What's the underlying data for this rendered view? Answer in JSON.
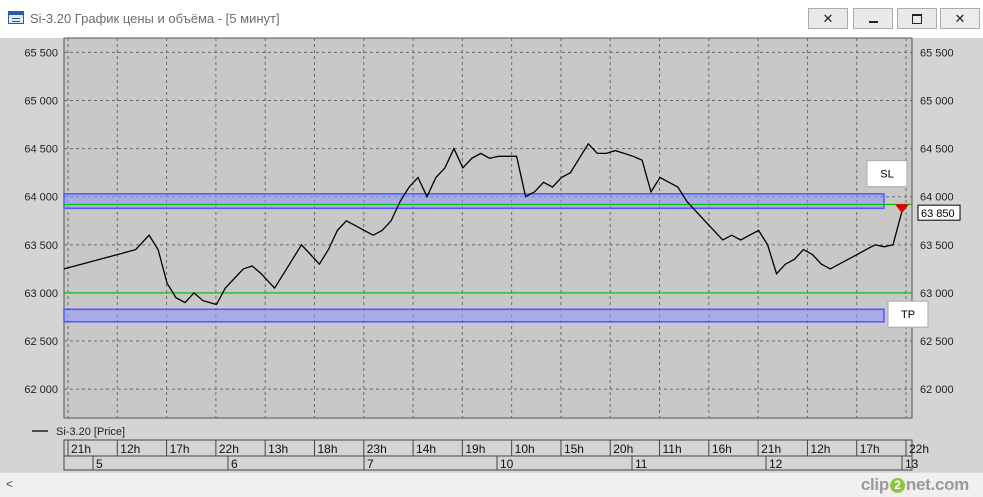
{
  "window": {
    "title": "Si-3.20 График цены и объёма - [5 минут]",
    "controls": [
      "pin-icon",
      "minimize-icon",
      "maximize-icon",
      "close-icon"
    ]
  },
  "watermark": {
    "prefix": "clip",
    "digit": "2",
    "suffix": "net.com"
  },
  "chart_data": {
    "type": "line",
    "title": "",
    "ylim": [
      61700,
      65650
    ],
    "grid": true,
    "y_ticks": [
      62000,
      62500,
      63000,
      63500,
      64000,
      64500,
      65000,
      65500
    ],
    "y_tick_labels": [
      "62 000",
      "62 500",
      "63 000",
      "63 500",
      "64 000",
      "64 500",
      "65 000",
      "65 500"
    ],
    "legend": {
      "position": "bottom-left",
      "entries": [
        "Si-3.20 [Price]"
      ]
    },
    "current_price_label": "63 850",
    "time_labels": [
      "21h",
      "12h",
      "17h",
      "22h",
      "13h",
      "18h",
      "23h",
      "14h",
      "19h",
      "10h",
      "15h",
      "20h",
      "11h",
      "16h",
      "21h",
      "12h",
      "17h",
      "22h"
    ],
    "date_labels": [
      "5",
      "6",
      "7",
      "10",
      "11",
      "12",
      "13"
    ],
    "series": [
      {
        "name": "Si-3.20 [Price]",
        "color": "#000000",
        "points": [
          [
            0,
            63250
          ],
          [
            2,
            63300
          ],
          [
            4,
            63350
          ],
          [
            6,
            63400
          ],
          [
            8,
            63450
          ],
          [
            9.5,
            63600
          ],
          [
            10.5,
            63450
          ],
          [
            11.5,
            63100
          ],
          [
            12.5,
            62950
          ],
          [
            13.5,
            62900
          ],
          [
            14.5,
            63000
          ],
          [
            15.5,
            62920
          ],
          [
            17,
            62880
          ],
          [
            18,
            63050
          ],
          [
            19,
            63150
          ],
          [
            20,
            63250
          ],
          [
            21,
            63280
          ],
          [
            22,
            63200
          ],
          [
            23,
            63100
          ],
          [
            23.5,
            63050
          ],
          [
            24.5,
            63200
          ],
          [
            25.5,
            63350
          ],
          [
            26.5,
            63500
          ],
          [
            27.5,
            63400
          ],
          [
            28.5,
            63300
          ],
          [
            29.5,
            63450
          ],
          [
            30.5,
            63650
          ],
          [
            31.5,
            63750
          ],
          [
            32.5,
            63700
          ],
          [
            33.5,
            63650
          ],
          [
            34.5,
            63600
          ],
          [
            35.5,
            63650
          ],
          [
            36.5,
            63750
          ],
          [
            37.5,
            63950
          ],
          [
            38.5,
            64100
          ],
          [
            39.5,
            64200
          ],
          [
            40.5,
            64000
          ],
          [
            41.5,
            64200
          ],
          [
            42.5,
            64300
          ],
          [
            43.5,
            64500
          ],
          [
            44.5,
            64300
          ],
          [
            45.5,
            64400
          ],
          [
            46.5,
            64450
          ],
          [
            47.5,
            64400
          ],
          [
            48.5,
            64420
          ],
          [
            49.5,
            64420
          ],
          [
            50.5,
            64420
          ],
          [
            51.5,
            64000
          ],
          [
            52.5,
            64050
          ],
          [
            53.5,
            64150
          ],
          [
            54.5,
            64100
          ],
          [
            55.5,
            64200
          ],
          [
            56.5,
            64250
          ],
          [
            57.5,
            64400
          ],
          [
            58.5,
            64550
          ],
          [
            59.5,
            64450
          ],
          [
            60.5,
            64450
          ],
          [
            61.5,
            64480
          ],
          [
            62.5,
            64450
          ],
          [
            63.5,
            64420
          ],
          [
            64.5,
            64380
          ],
          [
            65.5,
            64050
          ],
          [
            66.5,
            64200
          ],
          [
            67.5,
            64150
          ],
          [
            68.5,
            64100
          ],
          [
            69.5,
            63950
          ],
          [
            70.5,
            63850
          ],
          [
            71.5,
            63750
          ],
          [
            72.5,
            63650
          ],
          [
            73.5,
            63550
          ],
          [
            74.5,
            63600
          ],
          [
            75.5,
            63550
          ],
          [
            76.5,
            63600
          ],
          [
            77.5,
            63650
          ],
          [
            78.5,
            63500
          ],
          [
            79.5,
            63200
          ],
          [
            80.5,
            63300
          ],
          [
            81.5,
            63350
          ],
          [
            82.5,
            63450
          ],
          [
            83.5,
            63400
          ],
          [
            84.5,
            63300
          ],
          [
            85.5,
            63250
          ],
          [
            86.5,
            63300
          ],
          [
            87.5,
            63350
          ],
          [
            88.5,
            63400
          ],
          [
            89.5,
            63450
          ],
          [
            90.5,
            63500
          ],
          [
            91.5,
            63480
          ],
          [
            92.5,
            63500
          ],
          [
            93.5,
            63850
          ]
        ]
      }
    ],
    "levels": [
      {
        "name": "green-upper-level",
        "value": 63920,
        "color": "#00c000"
      },
      {
        "name": "green-lower-level",
        "value": 63000,
        "color": "#00c000"
      }
    ],
    "zones": [
      {
        "label": "SL",
        "from": 63880,
        "to": 64030,
        "color": "#4a5cff"
      },
      {
        "label": "TP",
        "from": 62700,
        "to": 62830,
        "color": "#4a5cff"
      }
    ],
    "marker": {
      "value": 63870,
      "direction": "down",
      "color": "#e00000"
    }
  }
}
